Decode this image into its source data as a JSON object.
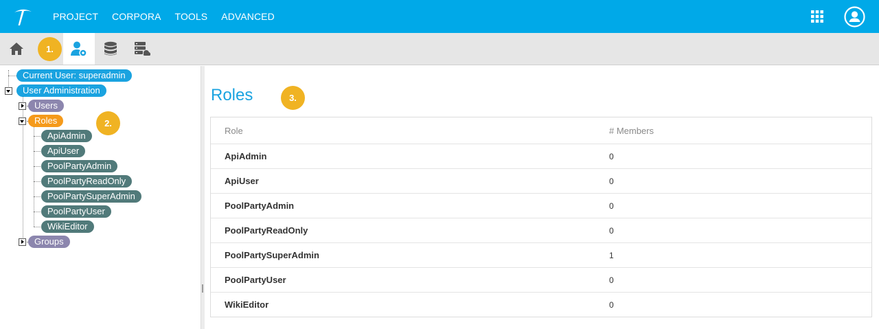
{
  "topbar": {
    "nav": [
      "PROJECT",
      "CORPORA",
      "TOOLS",
      "ADVANCED"
    ]
  },
  "annotations": [
    "1.",
    "2.",
    "3."
  ],
  "tree": {
    "current_user": "Current User: superadmin",
    "user_admin": "User Administration",
    "users": "Users",
    "roles": "Roles",
    "role_items": [
      "ApiAdmin",
      "ApiUser",
      "PoolPartyAdmin",
      "PoolPartyReadOnly",
      "PoolPartySuperAdmin",
      "PoolPartyUser",
      "WikiEditor"
    ],
    "groups": "Groups"
  },
  "main": {
    "title": "Roles",
    "columns": [
      "Role",
      "# Members"
    ],
    "rows": [
      {
        "role": "ApiAdmin",
        "members": "0"
      },
      {
        "role": "ApiUser",
        "members": "0"
      },
      {
        "role": "PoolPartyAdmin",
        "members": "0"
      },
      {
        "role": "PoolPartyReadOnly",
        "members": "0"
      },
      {
        "role": "PoolPartySuperAdmin",
        "members": "1"
      },
      {
        "role": "PoolPartyUser",
        "members": "0"
      },
      {
        "role": "WikiEditor",
        "members": "0"
      }
    ]
  },
  "colors": {
    "brand": "#00a9e8",
    "badge": "#f0b323",
    "role_pill": "#517a7a",
    "selected_node": "#f59a1b"
  }
}
